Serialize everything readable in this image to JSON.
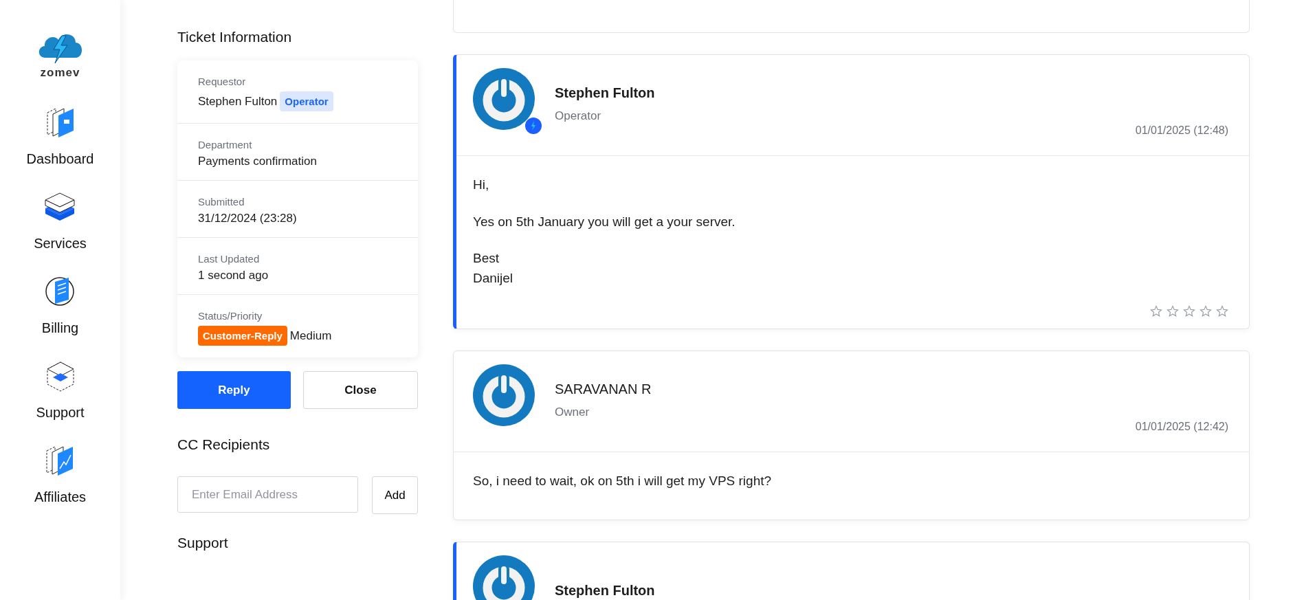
{
  "sidebar": {
    "logo_text": "zomev",
    "items": [
      {
        "label": "Dashboard",
        "kind": "dashboard"
      },
      {
        "label": "Services",
        "kind": "services"
      },
      {
        "label": "Billing",
        "kind": "billing"
      },
      {
        "label": "Support",
        "kind": "support"
      },
      {
        "label": "Affiliates",
        "kind": "affiliates"
      }
    ]
  },
  "ticket_info": {
    "title": "Ticket Information",
    "fields": [
      {
        "label": "Requestor",
        "value": "Stephen Fulton",
        "badge": "Operator",
        "kind": "role"
      },
      {
        "label": "Department",
        "value": "Payments confirmation",
        "kind": "text"
      },
      {
        "label": "Submitted",
        "value": "31/12/2024 (23:28)",
        "kind": "text"
      },
      {
        "label": "Last Updated",
        "value": "1 second ago",
        "kind": "text"
      },
      {
        "label": "Status/Priority",
        "badge": "Customer-Reply",
        "value": "Medium",
        "kind": "status"
      }
    ]
  },
  "actions": [
    {
      "label": "Reply",
      "kind": "primary"
    },
    {
      "label": "Close",
      "kind": "secondary"
    }
  ],
  "cc": {
    "title": "CC Recipients",
    "placeholder": "Enter Email Address",
    "button": "Add"
  },
  "next_section": {
    "title": "Support"
  },
  "messages": [
    {
      "author": "Stephen Fulton",
      "role": "Operator",
      "time": "01/01/2025 (12:48)",
      "staff": true,
      "body": [
        "Hi,",
        "Yes on 5th January you will get a your server.",
        "Best\nDanijel"
      ],
      "stars": 0
    },
    {
      "author": "SARAVANAN R",
      "role": "Owner",
      "time": "01/01/2025 (12:42)",
      "staff": false,
      "body": [
        "So, i need to wait, ok on 5th i will get my VPS right?"
      ]
    },
    {
      "author": "Stephen Fulton",
      "staff": true
    }
  ]
}
